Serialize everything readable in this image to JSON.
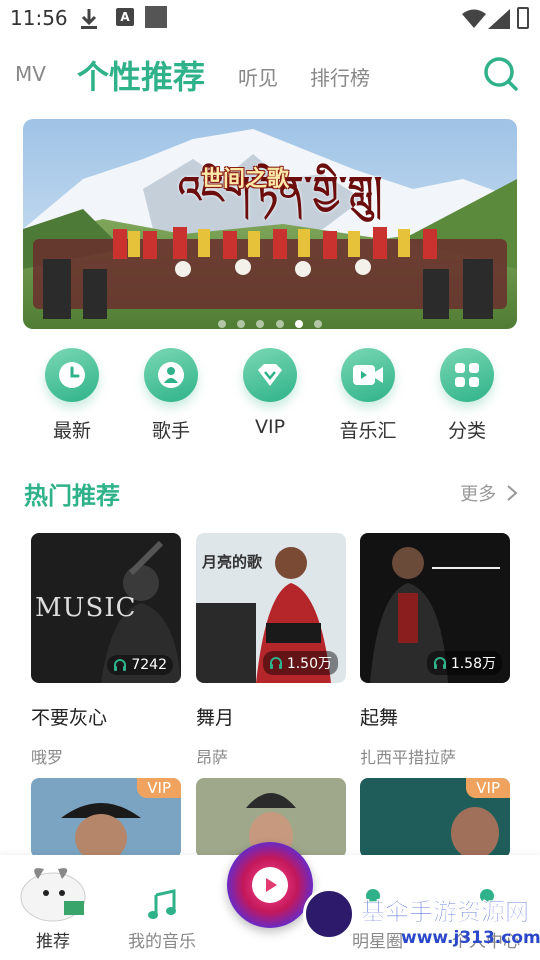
{
  "status_bar": {
    "time": "11:56",
    "a_icon": "A"
  },
  "top_nav": {
    "tabs": [
      {
        "label": "MV"
      },
      {
        "label": "个性推荐"
      },
      {
        "label": "听见"
      },
      {
        "label": "排行榜"
      }
    ],
    "active_index": 1,
    "accent_color": "#2fb289"
  },
  "banner": {
    "title_tibetan": "འཇིག་རྟེན་གྱི་གླུ།",
    "title_chinese": "世间之歌",
    "dot_count": 6,
    "active_dot": 4
  },
  "quick_actions": [
    {
      "label": "最新",
      "icon": "clock-icon"
    },
    {
      "label": "歌手",
      "icon": "singer-icon"
    },
    {
      "label": "VIP",
      "icon": "diamond-icon"
    },
    {
      "label": "音乐汇",
      "icon": "video-icon"
    },
    {
      "label": "分类",
      "icon": "grid-icon"
    }
  ],
  "hot_section": {
    "title": "热门推荐",
    "more_label": "更多",
    "cards": [
      {
        "title": "不要灰心",
        "artist": "哦罗",
        "plays": "7242",
        "cover_text": "MUSIC"
      },
      {
        "title": "舞月",
        "artist": "昂萨",
        "plays": "1.50万",
        "cover_text": "月亮的歌"
      },
      {
        "title": "起舞",
        "artist": "扎西平措拉萨",
        "plays": "1.58万",
        "cover_text": ""
      }
    ],
    "second_row": [
      {
        "vip": "VIP"
      },
      {
        "vip": ""
      },
      {
        "vip": "VIP"
      }
    ]
  },
  "bottom_nav": {
    "items": [
      {
        "label": "推荐"
      },
      {
        "label": "我的音乐"
      },
      {
        "label": "明星圈"
      },
      {
        "label": "个人中心"
      }
    ]
  },
  "watermark": {
    "text": "基伞手游资源网",
    "url": "www.j313.com"
  }
}
